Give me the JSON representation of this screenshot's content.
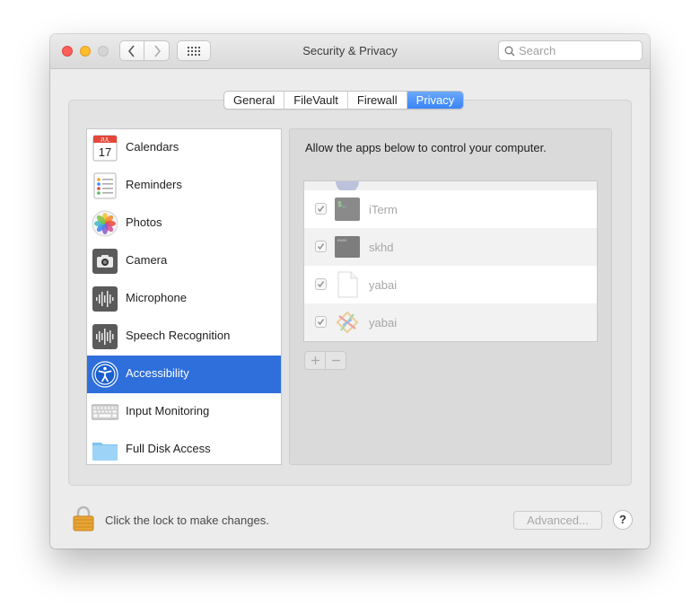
{
  "window": {
    "title": "Security & Privacy"
  },
  "search": {
    "placeholder": "Search"
  },
  "tabs": [
    {
      "label": "General"
    },
    {
      "label": "FileVault"
    },
    {
      "label": "Firewall"
    },
    {
      "label": "Privacy",
      "selected": true
    }
  ],
  "sidebar": {
    "items": [
      {
        "label": "Calendars",
        "icon": "calendar-icon",
        "icon_text": {
          "month": "JUL",
          "day": "17"
        }
      },
      {
        "label": "Reminders",
        "icon": "reminders-icon"
      },
      {
        "label": "Photos",
        "icon": "photos-icon"
      },
      {
        "label": "Camera",
        "icon": "camera-icon"
      },
      {
        "label": "Microphone",
        "icon": "microphone-icon"
      },
      {
        "label": "Speech Recognition",
        "icon": "speech-recognition-icon"
      },
      {
        "label": "Accessibility",
        "icon": "accessibility-icon",
        "selected": true
      },
      {
        "label": "Input Monitoring",
        "icon": "keyboard-icon"
      },
      {
        "label": "Full Disk Access",
        "icon": "folder-icon"
      }
    ]
  },
  "panel": {
    "description": "Allow the apps below to control your computer.",
    "apps": [
      {
        "name": "iTerm",
        "checked": true,
        "icon": "iterm-icon",
        "icon_text": "$_"
      },
      {
        "name": "skhd",
        "checked": true,
        "icon": "terminal-exec-icon",
        "icon_text": "exec"
      },
      {
        "name": "yabai",
        "checked": true,
        "icon": "document-icon"
      },
      {
        "name": "yabai",
        "checked": true,
        "icon": "yabai-icon"
      }
    ],
    "add_label": "+",
    "remove_label": "−"
  },
  "footer": {
    "lock_text": "Click the lock to make changes.",
    "advanced_label": "Advanced...",
    "help_label": "?"
  },
  "colors": {
    "selection": "#2f6fdc",
    "tab_active": "#3a84f5",
    "close": "#fd5f57",
    "minimize": "#febc2e"
  }
}
